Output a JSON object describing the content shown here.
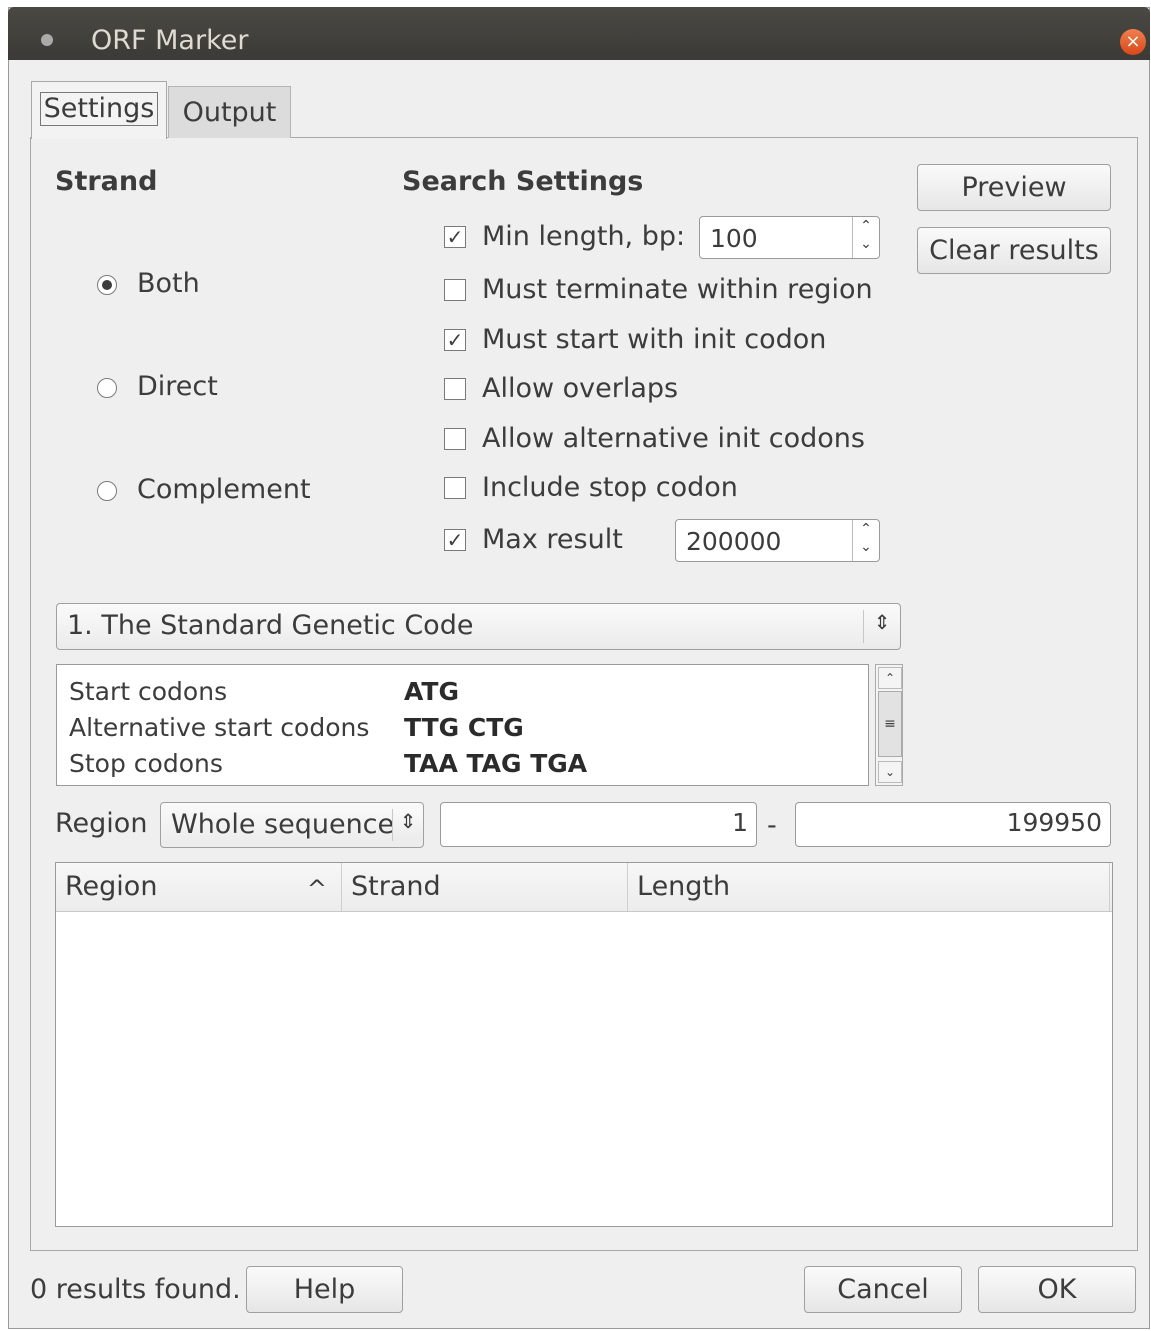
{
  "window": {
    "title": "ORF Marker"
  },
  "tabs": [
    {
      "label": "Settings"
    },
    {
      "label": "Output"
    }
  ],
  "strand": {
    "heading": "Strand",
    "options": [
      {
        "label": "Both",
        "selected": true
      },
      {
        "label": "Direct",
        "selected": false
      },
      {
        "label": "Complement",
        "selected": false
      }
    ]
  },
  "search": {
    "heading": "Search Settings",
    "min_length": {
      "label": "Min length, bp:",
      "checked": true,
      "value": "100"
    },
    "must_terminate": {
      "label": "Must terminate within region",
      "checked": false
    },
    "must_start": {
      "label": "Must start with init codon",
      "checked": true
    },
    "allow_overlaps": {
      "label": "Allow overlaps",
      "checked": false
    },
    "allow_alt_init": {
      "label": "Allow alternative init codons",
      "checked": false
    },
    "include_stop": {
      "label": "Include stop codon",
      "checked": false
    },
    "max_result": {
      "label": "Max result",
      "checked": true,
      "value": "200000"
    }
  },
  "buttons": {
    "preview": "Preview",
    "clear_results": "Clear results",
    "help": "Help",
    "cancel": "Cancel",
    "ok": "OK"
  },
  "genetic_code": {
    "selected": "1. The Standard Genetic Code",
    "rows": [
      {
        "label": "Start codons",
        "value": "ATG"
      },
      {
        "label": "Alternative start codons",
        "value": "TTG CTG"
      },
      {
        "label": "Stop codons",
        "value": "TAA TAG TGA"
      }
    ]
  },
  "region": {
    "label": "Region",
    "mode": "Whole sequence",
    "start": "1",
    "separator": "-",
    "end": "199950"
  },
  "results_table": {
    "columns": [
      "Region",
      "Strand",
      "Length"
    ],
    "sort_indicator": "^"
  },
  "status": {
    "text": "0 results found."
  },
  "icons": {
    "check": "✓",
    "spin": "⌃⌄",
    "combo": "⇕",
    "close": "×"
  }
}
